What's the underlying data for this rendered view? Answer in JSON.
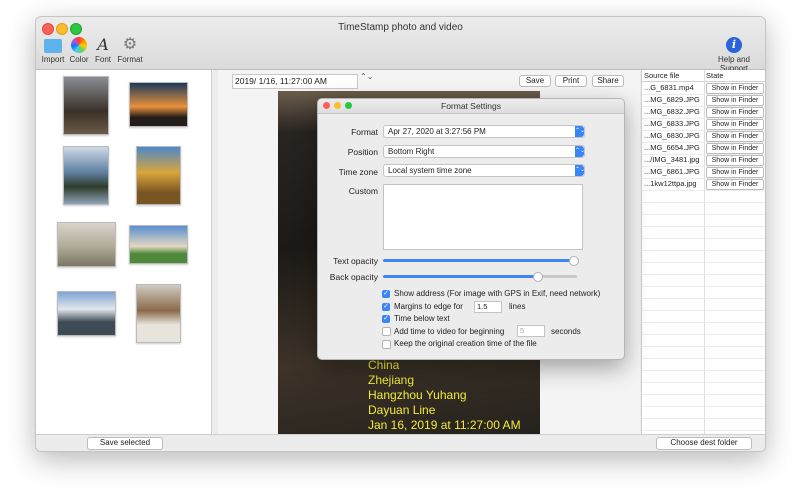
{
  "window": {
    "title": "TimeStamp photo and video"
  },
  "toolbar": {
    "import": "Import",
    "color": "Color",
    "font": "Font",
    "format": "Format",
    "help": "Help and Support",
    "help_icon": "i",
    "font_icon": "A",
    "gear_icon": "⚙"
  },
  "center": {
    "date_value": "2019/  1/16, 11:27:00 AM",
    "save": "Save",
    "print": "Print",
    "share": "Share",
    "stepper": "⌃⌄",
    "overlay_lines": [
      "China",
      "Zhejiang",
      "Hangzhou Yuhang",
      "Dayuan Line",
      "Jan 16, 2019 at 11:27:00 AM"
    ]
  },
  "left": {
    "save_selected": "Save selected"
  },
  "right": {
    "col_source": "Source file",
    "col_state": "State",
    "show_in_finder": "Show in Finder",
    "files": [
      "...G_6831.mp4",
      "...MG_6829.JPG",
      "...MG_6832.JPG",
      "...MG_6833.JPG",
      "...MG_6830.JPG",
      "...MG_6654.JPG",
      ".../IMG_3481.jpg",
      "...MG_6861.JPG",
      "...1kw12ttpa.jpg"
    ],
    "choose_dest": "Choose dest folder"
  },
  "dialog": {
    "title": "Format Settings",
    "format_label": "Format",
    "format_value": "Apr 27, 2020 at 3:27:56 PM",
    "position_label": "Position",
    "position_value": "Bottom Right",
    "timezone_label": "Time zone",
    "timezone_value": "Local system time zone",
    "custom_label": "Custom",
    "custom_value": "",
    "text_opacity_label": "Text opacity",
    "text_opacity": 1.0,
    "back_opacity_label": "Back opacity",
    "back_opacity": 0.78,
    "show_address": "Show address (For image with GPS in Exif, need network)",
    "margins_label": "Margins to edge for",
    "margins_value": "1.5",
    "margins_unit": "lines",
    "time_below": "Time below text",
    "add_time_label": "Add time to video for beginning",
    "add_time_value": "5",
    "add_time_unit": "seconds",
    "keep_original": "Keep the original creation time of the file",
    "arrow": "⌃⌄",
    "check": "✓"
  },
  "colors": {
    "accent": "#3b86f7",
    "overlay_text": "#f1ec3a",
    "close": "#fd5f57",
    "minimize": "#fdbc2e",
    "maximize": "#29c840"
  }
}
